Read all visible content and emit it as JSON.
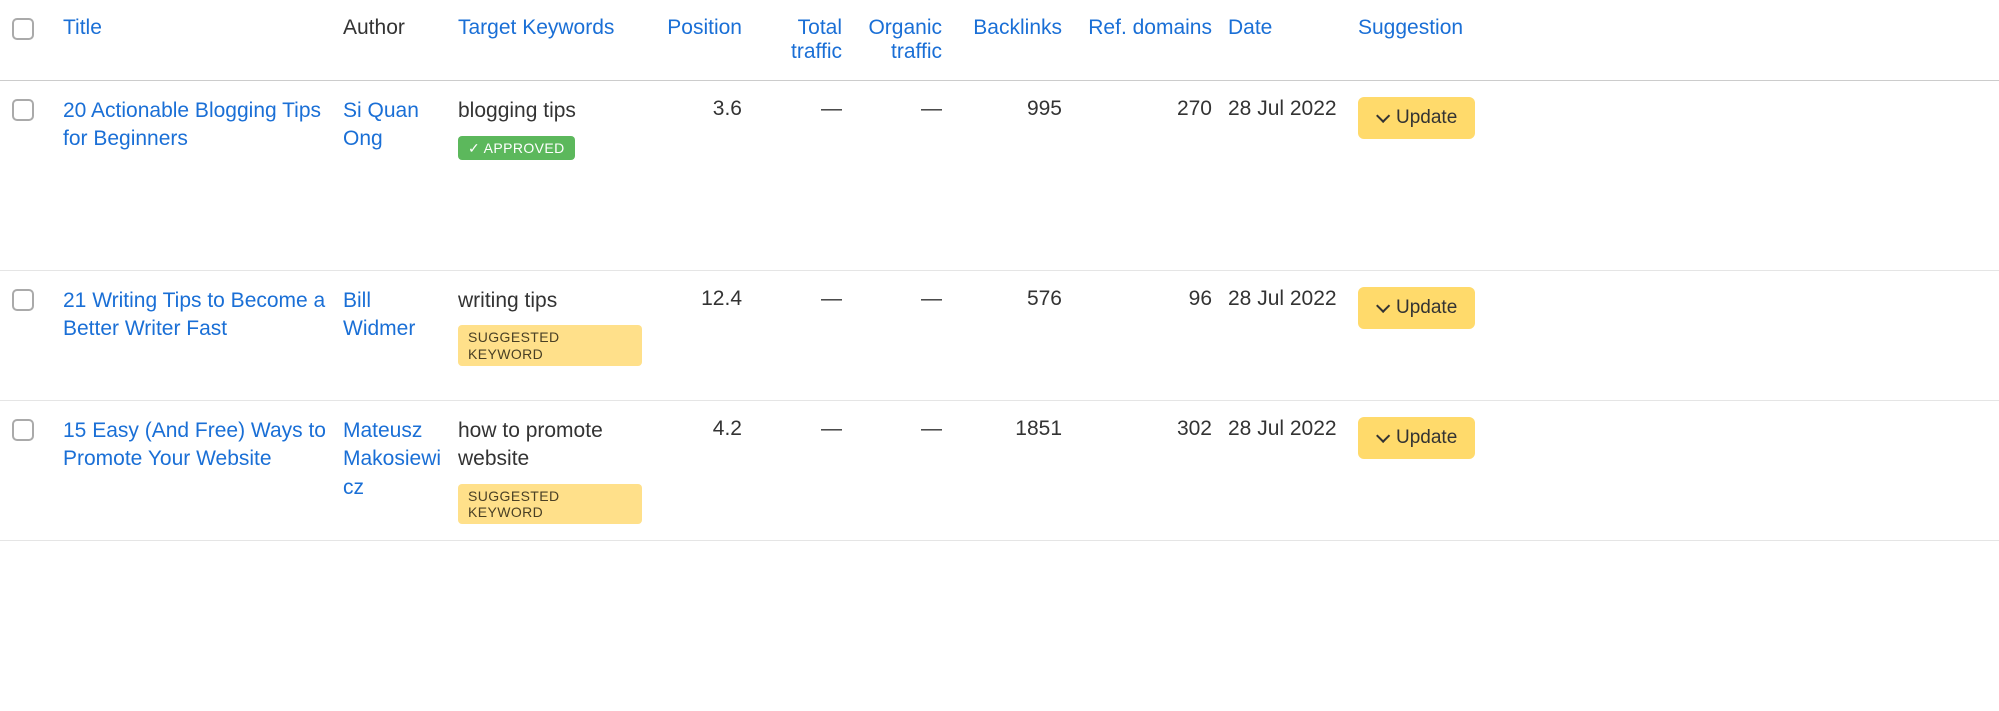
{
  "columns": {
    "title": "Title",
    "author": "Author",
    "target_keywords": "Target Keywords",
    "position": "Position",
    "total_traffic": "Total traffic",
    "organic_traffic": "Organic traffic",
    "backlinks": "Backlinks",
    "ref_domains": "Ref. domains",
    "date": "Date",
    "suggestion": "Suggestion"
  },
  "badges": {
    "approved": "APPROVED",
    "suggested": "SUGGESTED KEYWORD"
  },
  "buttons": {
    "update": "Update"
  },
  "dash": "—",
  "rows": [
    {
      "title": "20 Actionable Blogging Tips for Beginners",
      "author": "Si Quan Ong",
      "keyword": "blogging tips",
      "badge": "approved",
      "position": "3.6",
      "total_traffic": null,
      "organic_traffic": null,
      "backlinks": "995",
      "ref_domains": "270",
      "date": "28 Jul 2022"
    },
    {
      "title": "21 Writing Tips to Become a Better Writer Fast",
      "author": "Bill Widmer",
      "keyword": "writing tips",
      "badge": "suggested",
      "position": "12.4",
      "total_traffic": null,
      "organic_traffic": null,
      "backlinks": "576",
      "ref_domains": "96",
      "date": "28 Jul 2022"
    },
    {
      "title": "15 Easy (And Free) Ways to Promote Your Website",
      "author": "Mateusz Makosiewicz",
      "keyword": "how to promote website",
      "badge": "suggested",
      "position": "4.2",
      "total_traffic": null,
      "organic_traffic": null,
      "backlinks": "1851",
      "ref_domains": "302",
      "date": "28 Jul 2022"
    }
  ]
}
